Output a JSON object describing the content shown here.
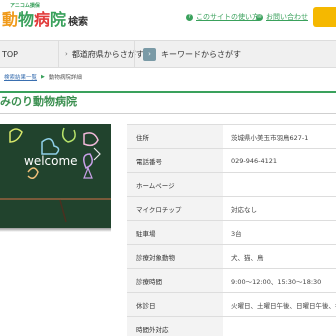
{
  "header": {
    "logo_small": "アニコム損保",
    "logo_parts": [
      "動",
      "物",
      "病",
      "院"
    ],
    "logo_suffix": "検索",
    "links": [
      {
        "icon": "?",
        "label": "このサイトの使い方"
      },
      {
        "icon": "✉",
        "label": "お問い合わせ"
      }
    ],
    "colors": {
      "accent": "#3aa15c",
      "logo_orange": "#f09a1a",
      "logo_red": "#e23a3a",
      "mypage": "#f5b800"
    }
  },
  "nav": {
    "top_label": "TOP",
    "pref_label": "都道府県からさがす",
    "keyword_label": "キーワードからさがす"
  },
  "breadcrumb": {
    "items": [
      "検索結果一覧",
      "動物病院詳細"
    ]
  },
  "page": {
    "title": "みのり動物病院",
    "photo_text": "welcome"
  },
  "info": {
    "rows": [
      {
        "key": "住所",
        "value": "茨城県小美玉市羽鳥627-1"
      },
      {
        "key": "電話番号",
        "value": "029-946-4121"
      },
      {
        "key": "ホームページ",
        "value": ""
      },
      {
        "key": "マイクロチップ",
        "value": "対応なし"
      },
      {
        "key": "駐車場",
        "value": "3台"
      },
      {
        "key": "診療対象動物",
        "value": "犬、猫、鳥"
      },
      {
        "key": "診療時間",
        "value": "9:00～12:00、15:30～18:30"
      },
      {
        "key": "休診日",
        "value": "火曜日、土曜日午後、日曜日午後、祝"
      },
      {
        "key": "時間外対応",
        "value": ""
      }
    ]
  }
}
